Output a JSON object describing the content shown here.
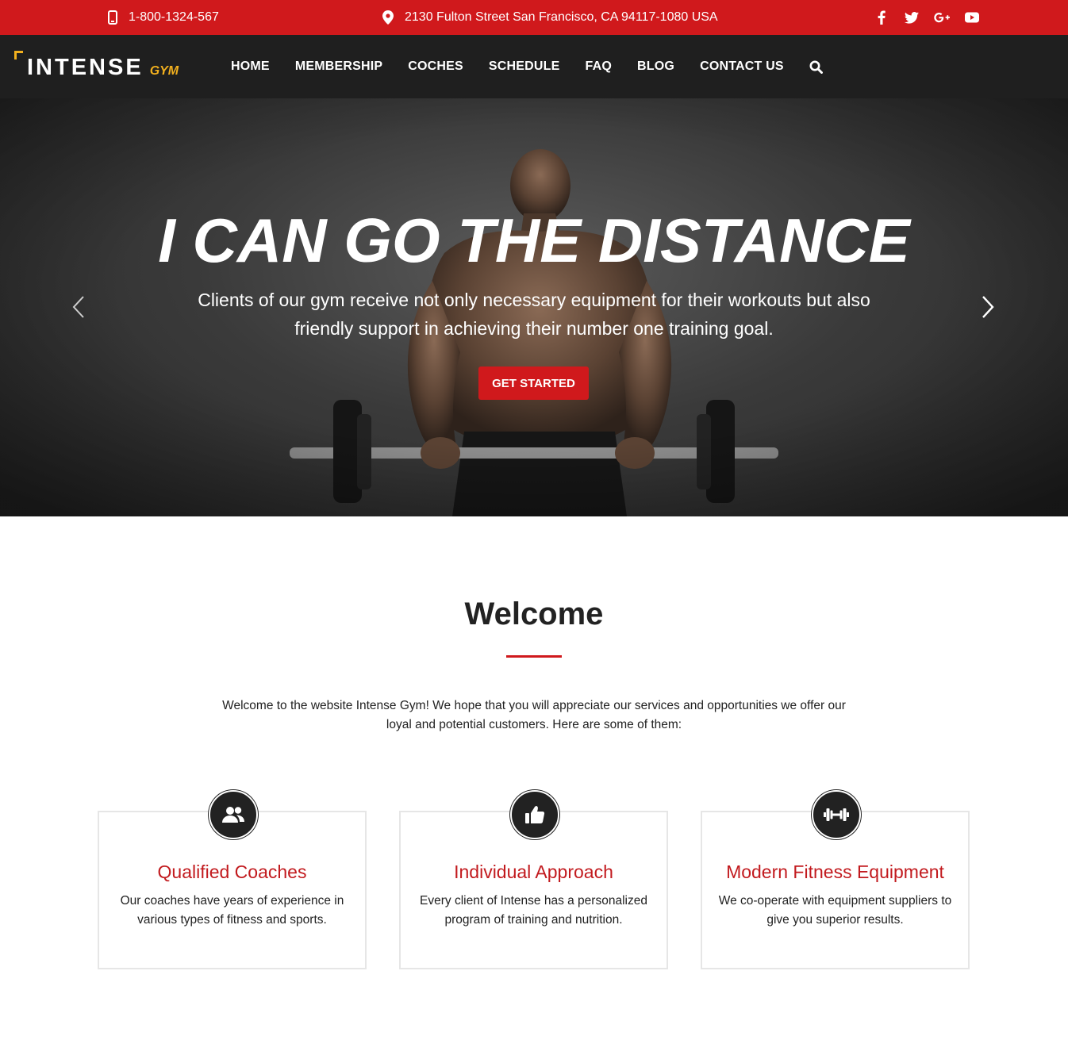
{
  "topbar": {
    "phone": "1-800-1324-567",
    "address": "2130 Fulton Street San Francisco, CA 94117-1080 USA",
    "social_icons": [
      "facebook-icon",
      "twitter-icon",
      "google-plus-icon",
      "youtube-icon"
    ]
  },
  "brand": {
    "name": "INTENSE",
    "suffix": "GYM"
  },
  "nav": {
    "items": [
      "HOME",
      "MEMBERSHIP",
      "COCHES",
      "SCHEDULE",
      "FAQ",
      "BLOG",
      "CONTACT US"
    ]
  },
  "hero": {
    "title": "I CAN GO THE DISTANCE",
    "subtitle_line1": "Clients of our gym receive not only necessary equipment for their workouts but also",
    "subtitle_line2": "friendly support in achieving their number one training goal.",
    "cta": "GET STARTED"
  },
  "welcome": {
    "title": "Welcome",
    "text_line1": "Welcome to the website Intense Gym! We hope that you will appreciate our services and opportunities we offer our",
    "text_line2": "loyal and potential customers. Here are some of them:"
  },
  "features": [
    {
      "title": "Qualified Coaches",
      "line1": "Our coaches have years of experience in",
      "line2": "various types of fitness and sports.",
      "icon": "users-icon"
    },
    {
      "title": "Individual Approach",
      "line1": "Every client of Intense has a personalized",
      "line2": "program of training and nutrition.",
      "icon": "thumbs-up-icon"
    },
    {
      "title": "Modern Fitness Equipment",
      "line1": "We co-operate with equipment suppliers to",
      "line2": "give you superior results.",
      "icon": "dumbbell-icon"
    }
  ],
  "colors": {
    "accent": "#d0191c",
    "dark": "#1f1f1f",
    "logo_yellow": "#f2b01e"
  }
}
